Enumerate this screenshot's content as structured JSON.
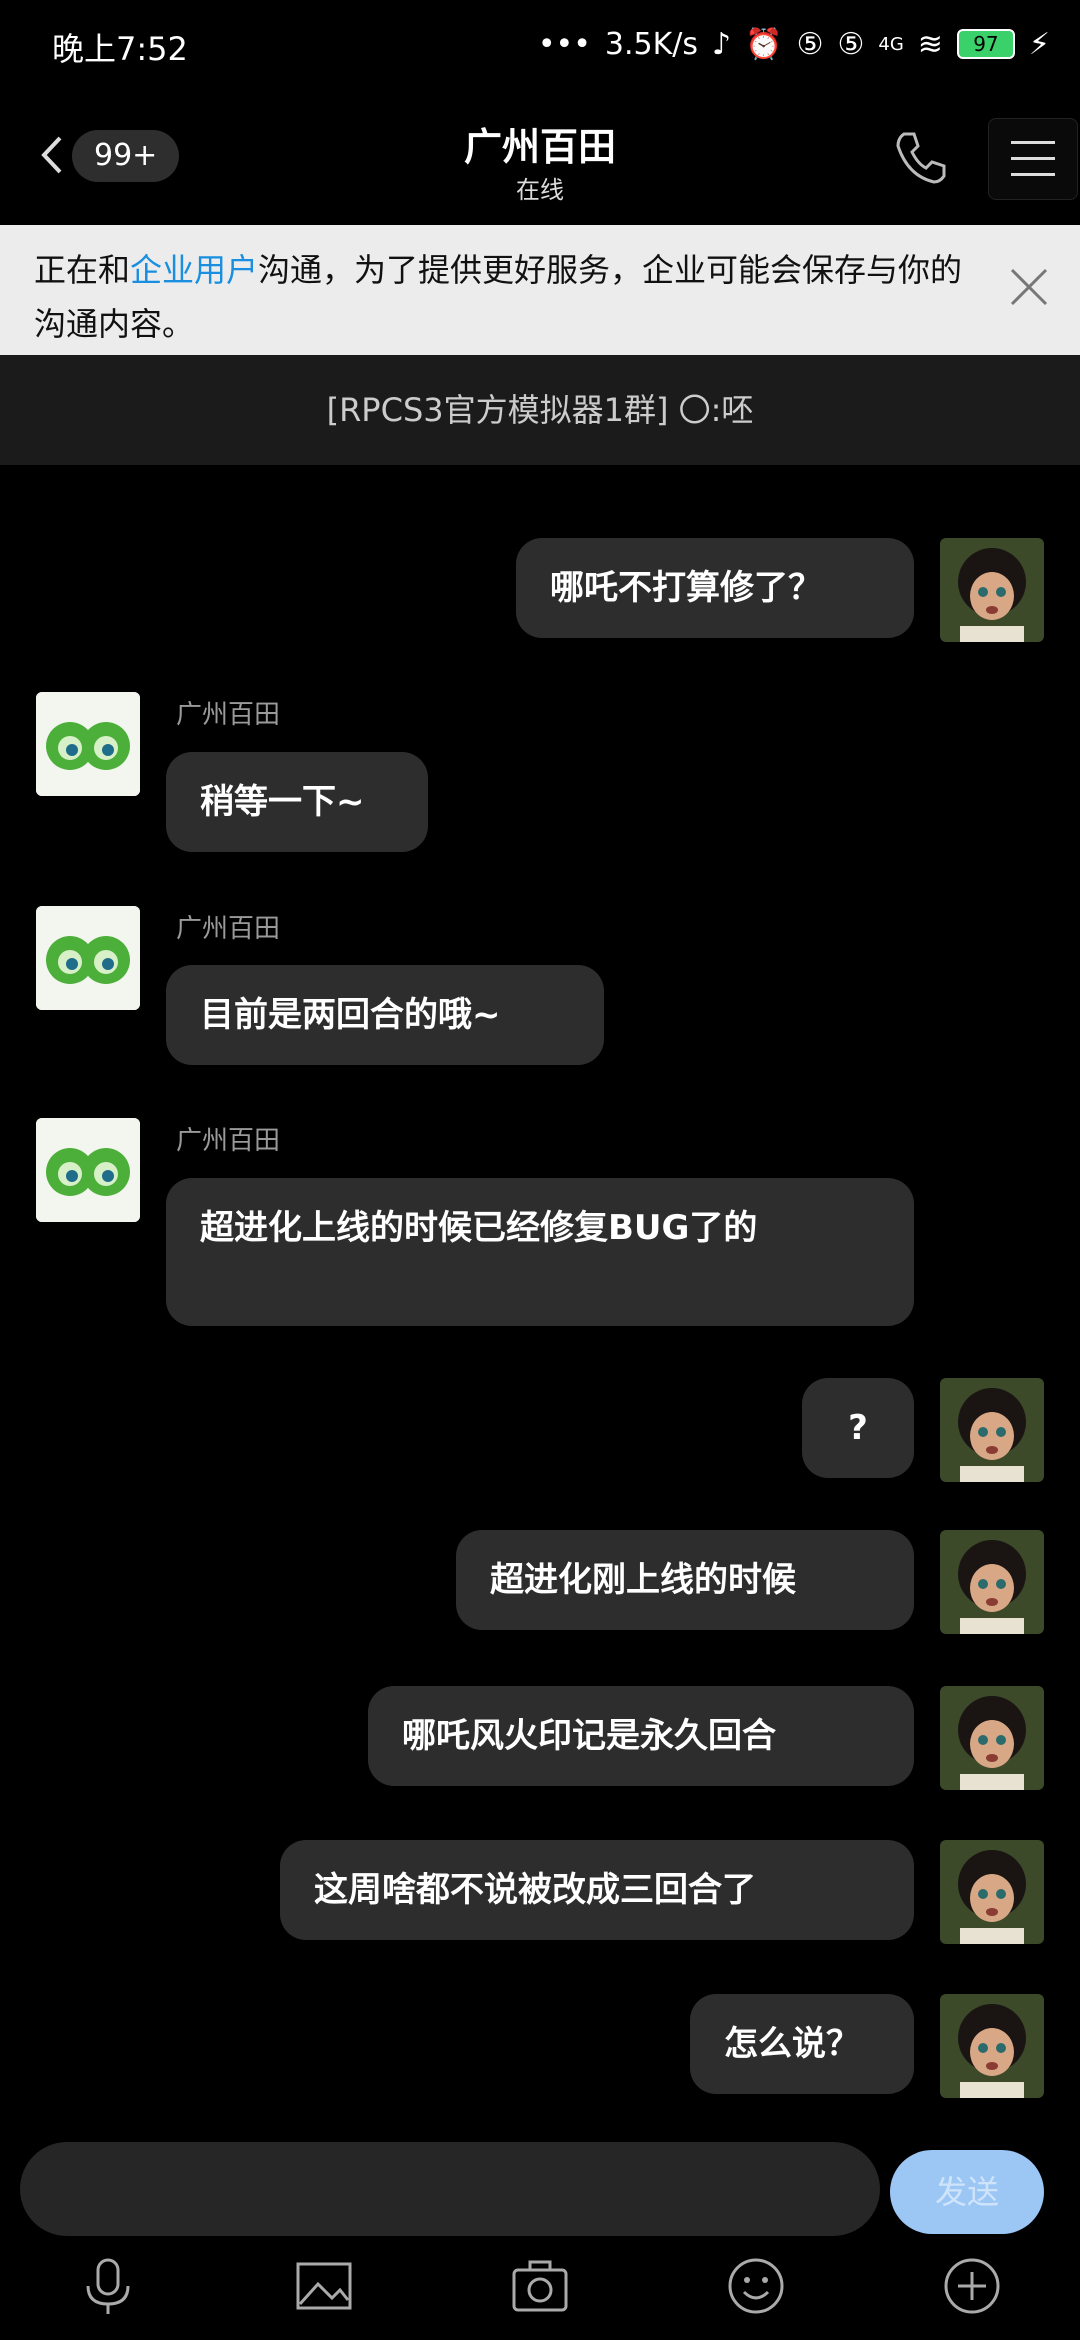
{
  "status_bar": {
    "time": "晚上7:52",
    "network_speed": "3.5K/s",
    "battery": "97"
  },
  "header": {
    "unread_badge": "99+",
    "title": "广州百田",
    "subtitle": "在线"
  },
  "notice": {
    "prefix": "正在和",
    "highlight": "企业用户",
    "suffix": "沟通，为了提供更好服务，企业可能会保存与你的沟通内容。"
  },
  "group_banner": "[RPCS3官方模拟器1群] 〇:呸",
  "messages": [
    {
      "side": "me",
      "text": "哪吒不打算修了？"
    },
    {
      "side": "bot",
      "sender": "广州百田",
      "text": "稍等一下~"
    },
    {
      "side": "bot",
      "sender": "广州百田",
      "text": "目前是两回合的哦~"
    },
    {
      "side": "bot",
      "sender": "广州百田",
      "text": "超进化上线的时候已经修复BUG了的"
    },
    {
      "side": "me",
      "text": "?"
    },
    {
      "side": "me",
      "text": "超进化刚上线的时候"
    },
    {
      "side": "me",
      "text": "哪吒风火印记是永久回合"
    },
    {
      "side": "me",
      "text": "这周啥都不说被改成三回合了"
    },
    {
      "side": "me",
      "text": "怎么说？"
    }
  ],
  "input": {
    "placeholder": "",
    "send_label": "发送"
  },
  "toolbar": [
    "microphone-icon",
    "image-icon",
    "camera-icon",
    "emoji-icon",
    "plus-icon"
  ],
  "colors": {
    "accent": "#1a8fe0",
    "send_button": "#9cc7f5",
    "bubble": "#2d2d2d"
  }
}
